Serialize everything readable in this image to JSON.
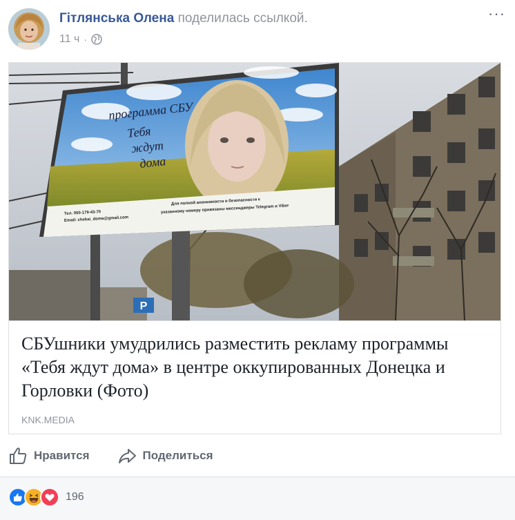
{
  "post": {
    "author_name": "Гітлянська Олена",
    "action_text": "поделилась ссылкой.",
    "timestamp": "11 ч",
    "separator": "·",
    "privacy_icon": "globe-icon",
    "more_icon": "more-options-icon",
    "more_label": "···"
  },
  "link": {
    "image_icon": "billboard-photo",
    "billboard_title_lines": [
      "программа СБУ",
      "Тебя",
      "ждут",
      "дома"
    ],
    "billboard_fine_print_left": [
      "Тел. 050-179-43-70",
      "Email: chekai_doma@gmail.com"
    ],
    "billboard_fine_print_right": [
      "Для полной анонимности и безопасности к",
      "указанному номеру привязаны мессенджеры Telegram и Viber"
    ],
    "title": "СБУшники умудрились разместить рекламу программы «Тебя ждут дома» в центре оккупированных Донецка и Горловки (Фото)",
    "domain": "KNK.MEDIA"
  },
  "actions": {
    "like_label": "Нравится",
    "share_label": "Поделиться"
  },
  "reactions": {
    "types": [
      "like",
      "haha",
      "love"
    ],
    "count": "196"
  },
  "colors": {
    "author": "#385898",
    "muted": "#90949c",
    "action": "#606770",
    "like_blue": "#1877f2",
    "haha_yellow": "#f7b125",
    "love_red": "#f33e58"
  }
}
